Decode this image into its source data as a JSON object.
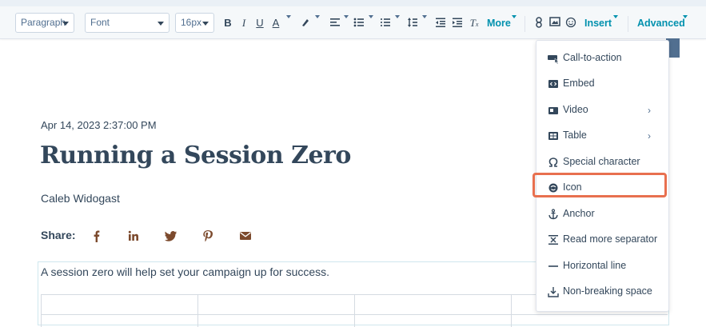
{
  "toolbar": {
    "paragraph_select": "Paragraph",
    "font_select": "Font",
    "size_select": "16px",
    "more_label": "More",
    "insert_label": "Insert",
    "advanced_label": "Advanced"
  },
  "post": {
    "date": "Apr 14, 2023 2:37:00 PM",
    "title": "Running a Session Zero",
    "author": "Caleb Widogast",
    "share_label": "Share:",
    "lead": "A session zero will help set your campaign up for success."
  },
  "insert_menu": {
    "items": [
      {
        "label": "Call-to-action",
        "icon": "cta-icon",
        "submenu": false
      },
      {
        "label": "Embed",
        "icon": "embed-icon",
        "submenu": false
      },
      {
        "label": "Video",
        "icon": "video-icon",
        "submenu": true
      },
      {
        "label": "Table",
        "icon": "table-icon",
        "submenu": true
      },
      {
        "label": "Special character",
        "icon": "omega-icon",
        "submenu": false
      },
      {
        "label": "Icon",
        "icon": "smiley-icon",
        "submenu": false
      },
      {
        "label": "Anchor",
        "icon": "anchor-icon",
        "submenu": false
      },
      {
        "label": "Read more separator",
        "icon": "read-more-icon",
        "submenu": false
      },
      {
        "label": "Horizontal line",
        "icon": "horizontal-line-icon",
        "submenu": false
      },
      {
        "label": "Non-breaking space",
        "icon": "nbsp-icon",
        "submenu": false
      }
    ],
    "highlighted": "Icon"
  },
  "colors": {
    "accent": "#0091ae",
    "text": "#33475b",
    "share_icons": "#7c4a2d",
    "highlight": "#e8704f"
  }
}
